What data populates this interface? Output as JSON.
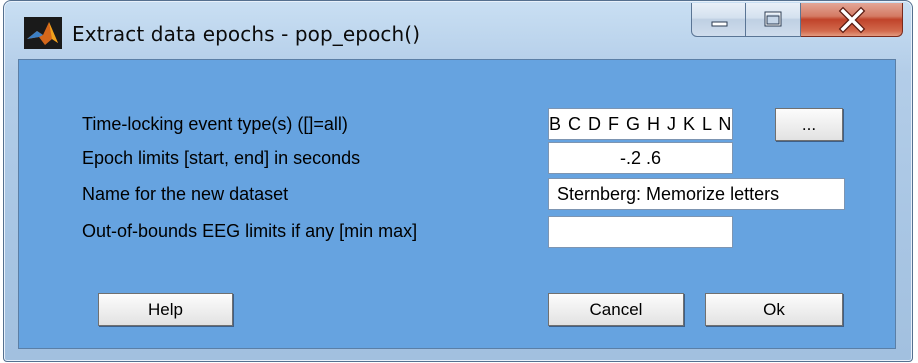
{
  "window": {
    "title": "Extract data epochs - pop_epoch()",
    "app_icon": "matlab-icon",
    "caption_buttons": [
      "minimize-icon",
      "maximize-icon",
      "close-icon"
    ]
  },
  "form": {
    "rows": [
      {
        "label": "Time-locking event type(s) ([]=all)",
        "value": "B C D F G H J K L N"
      },
      {
        "label": "Epoch limits [start, end] in seconds",
        "value": "-.2 .6"
      },
      {
        "label": "Name for the new dataset",
        "value": "Sternberg: Memorize letters"
      },
      {
        "label": "Out-of-bounds EEG limits if any [min max]",
        "value": ""
      }
    ],
    "browse_label": "..."
  },
  "buttons": {
    "help": "Help",
    "cancel": "Cancel",
    "ok": "Ok"
  },
  "colors": {
    "client_background": "#66a3e0",
    "close_button": "#c0432a"
  }
}
